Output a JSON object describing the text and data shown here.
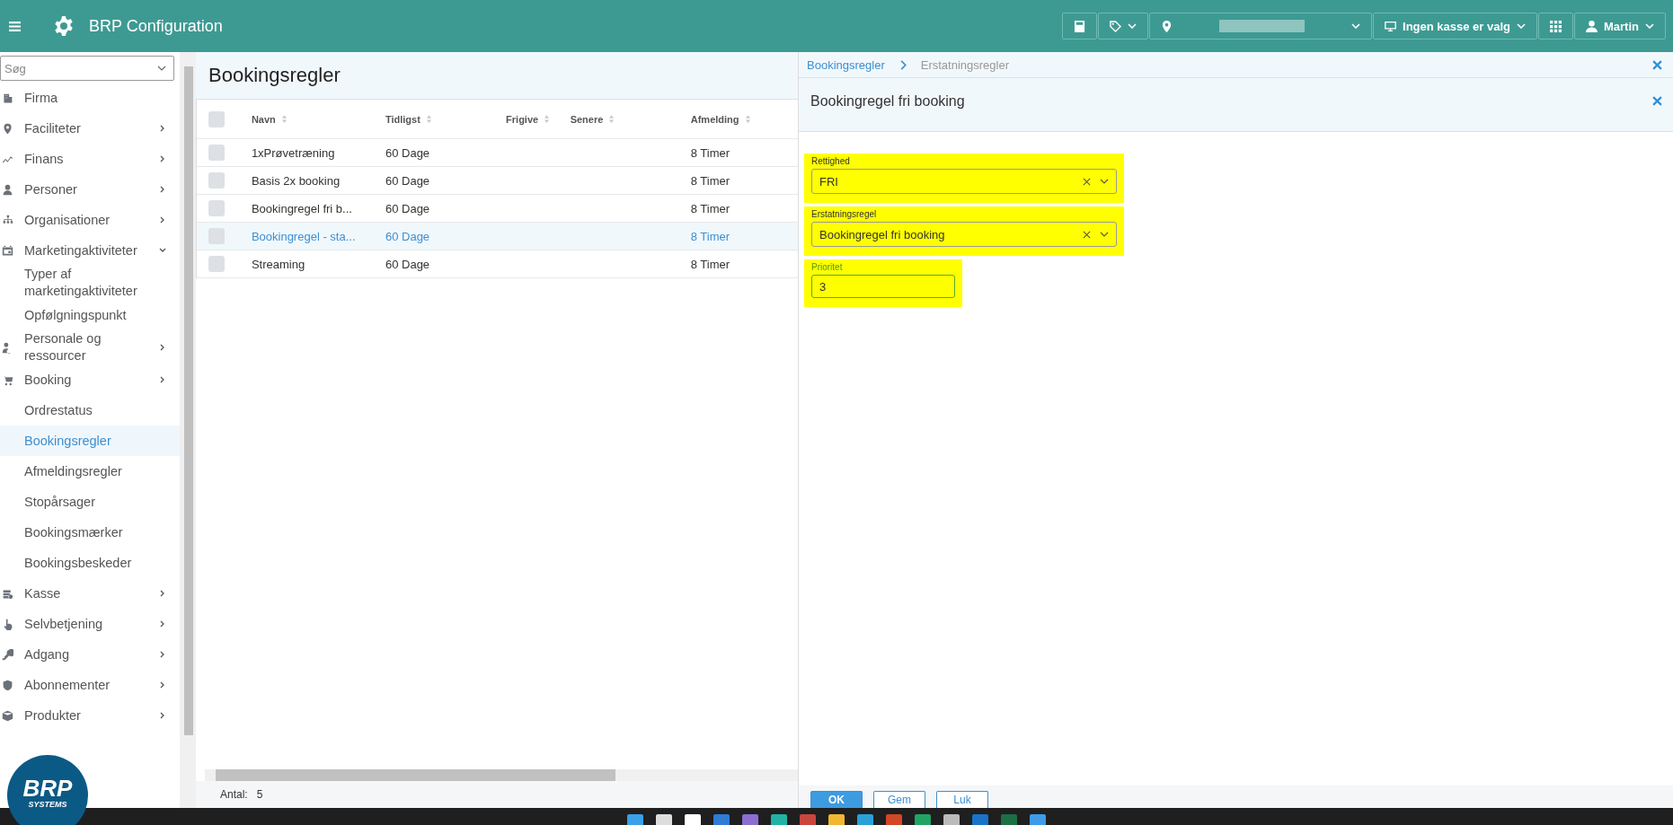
{
  "header": {
    "title": "BRP Configuration",
    "location_menu": {
      "blurred": true
    },
    "register_menu": {
      "label": "Ingen kasse er valg"
    },
    "user_menu": {
      "label": "Martin"
    }
  },
  "sidebar": {
    "search": {
      "placeholder": "Søg"
    },
    "items": [
      {
        "label": "Firma",
        "selected": false
      },
      {
        "label": "Faciliteter",
        "selected": false,
        "expanded": false
      },
      {
        "label": "Finans",
        "selected": false,
        "expanded": false
      },
      {
        "label": "Personer",
        "selected": false,
        "expanded": false
      },
      {
        "label": "Organisationer",
        "selected": false,
        "expanded": false
      },
      {
        "label": "Marketingaktiviteter",
        "selected": false,
        "expanded": true,
        "children": [
          {
            "label": "Typer af marketingaktiviteter",
            "selected": false
          },
          {
            "label": "Opfølgningspunkt",
            "selected": false
          }
        ]
      },
      {
        "label": "Personale og ressourcer",
        "selected": false,
        "expanded": false
      },
      {
        "label": "Booking",
        "selected": false,
        "expanded": false,
        "children": [
          {
            "label": "Ordrestatus",
            "selected": false
          },
          {
            "label": "Bookingsregler",
            "selected": true
          },
          {
            "label": "Afmeldingsregler",
            "selected": false
          },
          {
            "label": "Stopårsager",
            "selected": false
          },
          {
            "label": "Bookingsmærker",
            "selected": false
          },
          {
            "label": "Bookingsbeskeder",
            "selected": false
          }
        ]
      },
      {
        "label": "Kasse",
        "selected": false,
        "expanded": false
      },
      {
        "label": "Selvbetjening",
        "selected": false,
        "expanded": false
      },
      {
        "label": "Adgang",
        "selected": false,
        "expanded": false
      },
      {
        "label": "Abonnementer",
        "selected": false,
        "expanded": false
      },
      {
        "label": "Produkter",
        "selected": false,
        "expanded": false
      }
    ]
  },
  "logo": {
    "name": "BRP",
    "tagline": "SYSTEMS"
  },
  "list": {
    "title": "Bookingsregler",
    "table": {
      "select_all": {
        "checked": false
      },
      "columns": [
        "Navn",
        "Tidligst",
        "Frigive",
        "Senere",
        "Afmelding"
      ],
      "rows": [
        {
          "cells": [
            "1xPrøvetræning",
            "60 Dage",
            "",
            "",
            "8 Timer"
          ],
          "selected": false,
          "checked": false
        },
        {
          "cells": [
            "Basis 2x booking",
            "60 Dage",
            "",
            "",
            "8 Timer"
          ],
          "selected": false,
          "checked": false
        },
        {
          "cells": [
            "Bookingregel fri b...",
            "60 Dage",
            "",
            "",
            "8 Timer"
          ],
          "selected": false,
          "checked": false
        },
        {
          "cells": [
            "Bookingregel - sta...",
            "60 Dage",
            "",
            "",
            "8 Timer"
          ],
          "selected": true,
          "checked": false
        },
        {
          "cells": [
            "Streaming",
            "60 Dage",
            "",
            "",
            "8 Timer"
          ],
          "selected": false,
          "checked": false
        }
      ]
    },
    "count": {
      "label": "Antal:",
      "value": "5"
    }
  },
  "detail": {
    "breadcrumb": [
      "Bookingsregler",
      "Erstatningsregler"
    ],
    "title": "Bookingregel fri booking",
    "fields": [
      {
        "kind": "select",
        "label": "Rettighed",
        "value": "FRI",
        "highlighted": true,
        "focused": false
      },
      {
        "kind": "select",
        "label": "Erstatningsregel",
        "value": "Bookingregel fri booking",
        "highlighted": true,
        "focused": false
      },
      {
        "kind": "text",
        "label": "Prioritet",
        "value": "3",
        "highlighted": true,
        "focused": true
      }
    ],
    "buttons": [
      {
        "label": "OK",
        "primary": true
      },
      {
        "label": "Gem",
        "primary": false
      },
      {
        "label": "Luk",
        "primary": false
      }
    ]
  }
}
